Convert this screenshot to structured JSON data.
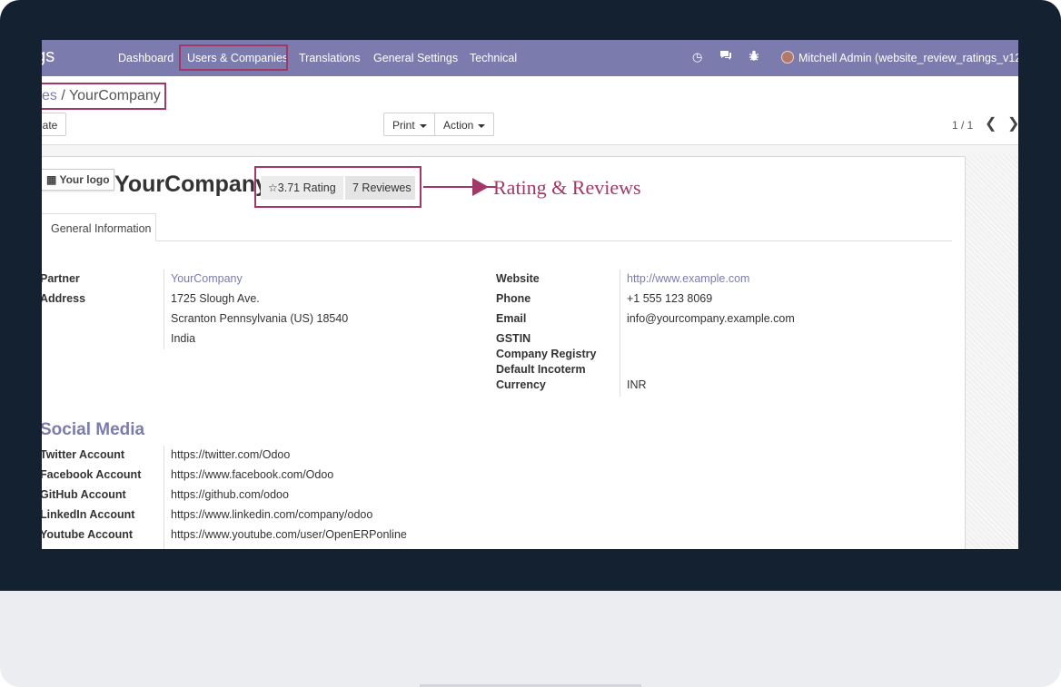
{
  "navbar": {
    "brand": "ngs",
    "menu": [
      "Dashboard",
      "Users & Companies",
      "Translations",
      "General Settings",
      "Technical"
    ],
    "user": "Mitchell Admin (website_review_ratings_v12)"
  },
  "breadcrumb": {
    "parent": "es",
    "separator": " / ",
    "current": "YourCompany"
  },
  "toolbar": {
    "create_label": "eate",
    "print_label": "Print",
    "action_label": "Action"
  },
  "pager": {
    "text": "1 / 1"
  },
  "form": {
    "logo_label": "Your logo",
    "company_name": "YourCompany",
    "rating_label": "3.71 Rating",
    "reviews_label": "7 Reviewes",
    "annotation": "Rating & Reviews",
    "tab_label": "General Information",
    "left": {
      "partner_label": "Partner",
      "partner_value": "YourCompany",
      "address_label": "Address",
      "address_lines": [
        "1725 Slough Ave.",
        "Scranton  Pennsylvania (US)  18540",
        "India"
      ]
    },
    "right": {
      "website_label": "Website",
      "website_value": "http://www.example.com",
      "phone_label": "Phone",
      "phone_value": "+1 555 123 8069",
      "email_label": "Email",
      "email_value": "info@yourcompany.example.com",
      "gstin_label": "GSTIN",
      "registry_label": "Company Registry",
      "incoterm_label": "Default Incoterm",
      "currency_label": "Currency",
      "currency_value": "INR"
    },
    "social": {
      "title": "Social Media",
      "rows": [
        {
          "label": "Twitter Account",
          "value": "https://twitter.com/Odoo"
        },
        {
          "label": "Facebook Account",
          "value": "https://www.facebook.com/Odoo"
        },
        {
          "label": "GitHub Account",
          "value": "https://github.com/odoo"
        },
        {
          "label": "LinkedIn Account",
          "value": "https://www.linkedin.com/company/odoo"
        },
        {
          "label": "Youtube Account",
          "value": "https://www.youtube.com/user/OpenERPonline"
        }
      ]
    }
  },
  "colors": {
    "brand": "#7c7bad",
    "highlight": "#a23866",
    "bezel": "#142130"
  }
}
